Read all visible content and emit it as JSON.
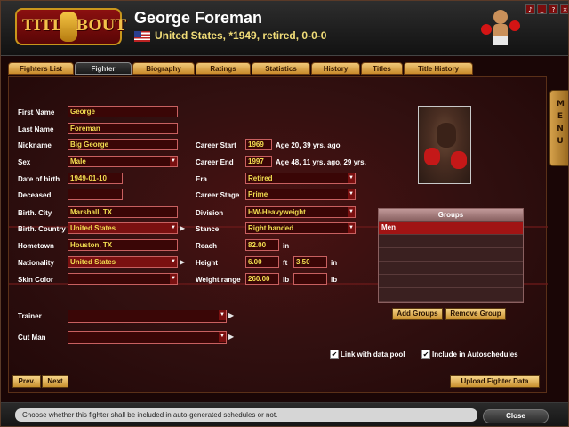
{
  "header": {
    "logo_left": "TITLE",
    "logo_right": "BOUT",
    "fighter_name": "George Foreman",
    "fighter_subtitle": "United States, *1949, retired, 0-0-0",
    "flag": "us-flag-icon"
  },
  "tabs": [
    {
      "label": "Fighters List",
      "active": false
    },
    {
      "label": "Fighter",
      "active": true
    },
    {
      "label": "Biography",
      "active": false
    },
    {
      "label": "Ratings",
      "active": false
    },
    {
      "label": "Statistics",
      "active": false
    },
    {
      "label": "History",
      "active": false
    },
    {
      "label": "Titles",
      "active": false
    },
    {
      "label": "Title History",
      "active": false
    }
  ],
  "menu_label": "MENU",
  "form": {
    "first_name": {
      "label": "First Name",
      "value": "George"
    },
    "last_name": {
      "label": "Last Name",
      "value": "Foreman"
    },
    "nickname": {
      "label": "Nickname",
      "value": "Big George"
    },
    "sex": {
      "label": "Sex",
      "value": "Male"
    },
    "dob": {
      "label": "Date of birth",
      "value": "1949-01-10"
    },
    "deceased": {
      "label": "Deceased",
      "value": ""
    },
    "birth_city": {
      "label": "Birth. City",
      "value": "Marshall, TX"
    },
    "birth_country": {
      "label": "Birth. Country",
      "value": "United States"
    },
    "hometown": {
      "label": "Hometown",
      "value": "Houston, TX"
    },
    "nationality": {
      "label": "Nationality",
      "value": "United States"
    },
    "skin_color": {
      "label": "Skin Color",
      "value": ""
    },
    "career_start": {
      "label": "Career Start",
      "value": "1969",
      "note": "Age 20, 39 yrs. ago"
    },
    "career_end": {
      "label": "Career End",
      "value": "1997",
      "note": "Age 48, 11 yrs. ago, 29 yrs."
    },
    "era": {
      "label": "Era",
      "value": "Retired"
    },
    "career_stage": {
      "label": "Career Stage",
      "value": "Prime"
    },
    "division": {
      "label": "Division",
      "value": "HW-Heavyweight"
    },
    "stance": {
      "label": "Stance",
      "value": "Right handed"
    },
    "reach": {
      "label": "Reach",
      "value": "82.00",
      "unit": "in"
    },
    "height": {
      "label": "Height",
      "ft": "6.00",
      "ft_unit": "ft",
      "in": "3.50",
      "in_unit": "in"
    },
    "weight": {
      "label": "Weight range",
      "value": "260.00",
      "unit1": "lb",
      "value2": "",
      "unit2": "lb"
    },
    "trainer": {
      "label": "Trainer",
      "value": ""
    },
    "cutman": {
      "label": "Cut Man",
      "value": ""
    }
  },
  "groups": {
    "title": "Groups",
    "rows": [
      "Men",
      "",
      "",
      "",
      "",
      ""
    ],
    "add_label": "Add Groups",
    "remove_label": "Remove Group"
  },
  "checks": {
    "link_pool": {
      "label": "Link with data pool",
      "checked": true
    },
    "autoschedule": {
      "label": "Include in Autoschedules",
      "checked": true
    }
  },
  "nav": {
    "prev": "Prev.",
    "next": "Next",
    "upload": "Upload Fighter Data"
  },
  "status": {
    "message": "Choose whether this fighter shall be included in auto-generated schedules or not.",
    "close": "Close"
  },
  "colors": {
    "field_text": "#f2de50",
    "field_border": "#c86060",
    "tab_gold": "#e0b060",
    "selected_row": "#a01414"
  }
}
